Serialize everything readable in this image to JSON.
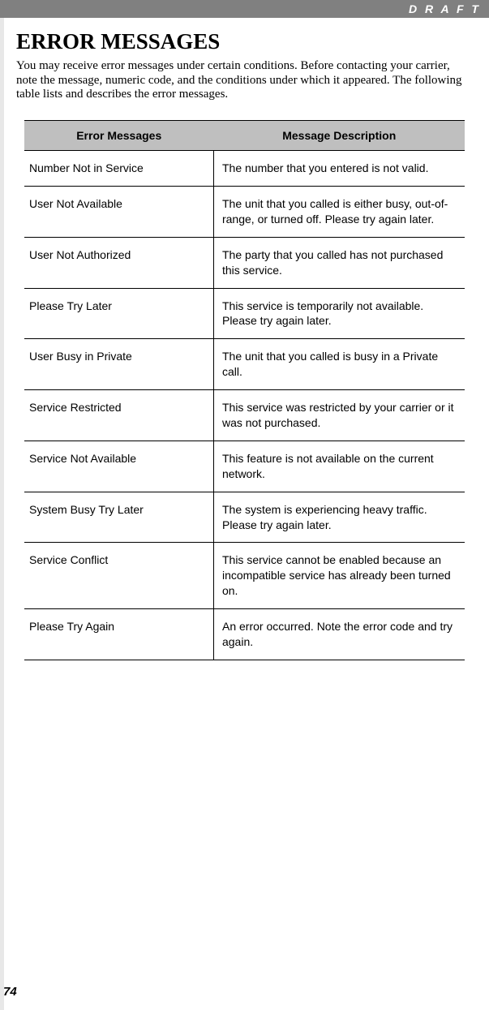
{
  "header": {
    "watermark": "D R A F T"
  },
  "title": "ERROR MESSAGES",
  "intro": "You may receive error messages under certain conditions. Before contacting your carrier, note the message, numeric code, and the conditions under which it appeared. The following table lists and describes the error messages.",
  "table": {
    "headers": {
      "col1": "Error Messages",
      "col2": "Message Description"
    },
    "rows": [
      {
        "msg": "Number Not in Service",
        "desc": "The number that you entered is not valid."
      },
      {
        "msg": "User Not Available",
        "desc": "The unit that you called is either busy, out-of-range, or turned off. Please try again later."
      },
      {
        "msg": "User Not Authorized",
        "desc": "The party that you called has not purchased this service."
      },
      {
        "msg": "Please Try Later",
        "desc": "This service is temporarily not available. Please try again later."
      },
      {
        "msg": "User Busy in Private",
        "desc": "The unit that you called is busy in a Private call."
      },
      {
        "msg": "Service Restricted",
        "desc": "This service was restricted by your carrier or it was not purchased."
      },
      {
        "msg": "Service Not Available",
        "desc": "This feature is not available on the current network."
      },
      {
        "msg": "System Busy Try Later",
        "desc": "The system is experiencing heavy traffic. Please try again later."
      },
      {
        "msg": "Service Conflict",
        "desc": "This service cannot be enabled because an incompatible service has already been turned on."
      },
      {
        "msg": "Please Try Again",
        "desc": "An error occurred. Note the error code and try again."
      }
    ]
  },
  "page_number": "74"
}
